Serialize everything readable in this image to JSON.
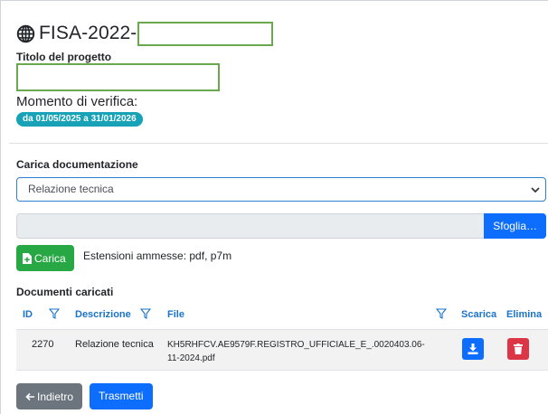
{
  "header": {
    "project_code_prefix": "FISA-2022-",
    "title_label": "Titolo del progetto",
    "verify_label": "Momento di verifica:",
    "date_badge": "da 01/05/2025 a 31/01/2026"
  },
  "upload": {
    "section_label": "Carica documentazione",
    "selected_type": "Relazione tecnica",
    "browse_label": "Sfoglia…",
    "upload_label": "Carica",
    "extensions_text": "Estensioni ammesse: pdf, p7m"
  },
  "documents": {
    "section_label": "Documenti caricati",
    "columns": {
      "id": "ID",
      "description": "Descrizione",
      "file": "File",
      "download": "Scarica",
      "delete": "Elimina"
    },
    "rows": [
      {
        "id": "2270",
        "description": "Relazione tecnica",
        "file": "KH5RHFCV.AE9579F.REGISTRO_UFFICIALE_E_.0020403.06-11-2024.pdf"
      }
    ]
  },
  "footer": {
    "back_label": "Indietro",
    "submit_label": "Trasmetti"
  },
  "colors": {
    "primary": "#0d6efd",
    "success": "#28a745",
    "danger": "#dc3545",
    "secondary": "#6c757d",
    "info_badge": "#17a2b8",
    "redaction_border": "#6aa84f"
  },
  "icons": {
    "project": "globe-icon",
    "upload": "file-plus-icon",
    "filter": "filter-icon",
    "download": "download-icon",
    "delete": "trash-icon",
    "back": "arrow-left-icon",
    "select": "chevron-down-icon"
  }
}
